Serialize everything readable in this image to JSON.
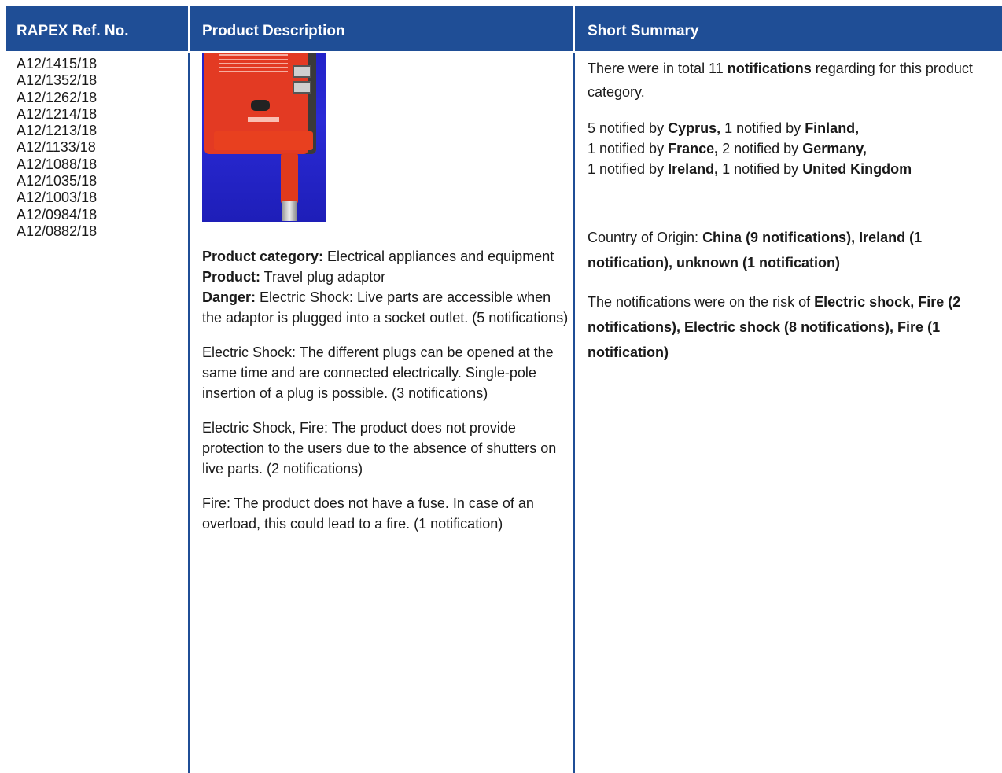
{
  "header": {
    "col1": "RAPEX Ref. No.",
    "col2": "Product Description",
    "col3": "Short Summary"
  },
  "refs": [
    "A12/1415/18",
    "A12/1352/18",
    "A12/1262/18",
    "A12/1214/18",
    "A12/1213/18",
    "A12/1133/18",
    "A12/1088/18",
    "A12/1035/18",
    "A12/1003/18",
    "A12/0984/18",
    "A12/0882/18"
  ],
  "description": {
    "category_label": "Product category:",
    "category_value": " Electrical appliances and equipment",
    "product_label": "Product:",
    "product_value": " Travel plug adaptor",
    "danger_label": "Danger:",
    "danger_value": " Electric Shock: Live parts are accessible when the adaptor is plugged into a socket outlet. (5 notifications)",
    "para2": "Electric Shock: The different plugs can be opened at the same time and are connected electrically. Single-pole insertion of a plug is possible. (3 notifications)",
    "para3": "Electric Shock, Fire: The product does not provide protection to the users due to the absence of shutters on live parts. (2 notifications)",
    "para4": "Fire: The product does not have a fuse. In case of an overload, this could lead to a fire. (1 notification)"
  },
  "summary": {
    "s1a": "There were in total 11 ",
    "s1b": "notifications",
    "s1c": " regarding for this product category.",
    "n1": "5 notified by ",
    "c1": "Cyprus,",
    "n2": " 1 notified by ",
    "c2": "Finland,",
    "n3": "1 notified by ",
    "c3": "France,",
    "n4": " 2 notified by ",
    "c4": "Germany,",
    "n5": "1 notified by ",
    "c5": "Ireland,",
    "n6": " 1 notified by ",
    "c6": "United Kingdom",
    "origin_label": "Country of Origin: ",
    "origin_value": "China (9 notifications), Ireland (1 notification), unknown (1 notification)",
    "risk_label": "The notifications were on the risk of  ",
    "risk_value": "Electric shock, Fire (2 notifications), Electric shock (8 notifications), Fire (1 notification)"
  }
}
